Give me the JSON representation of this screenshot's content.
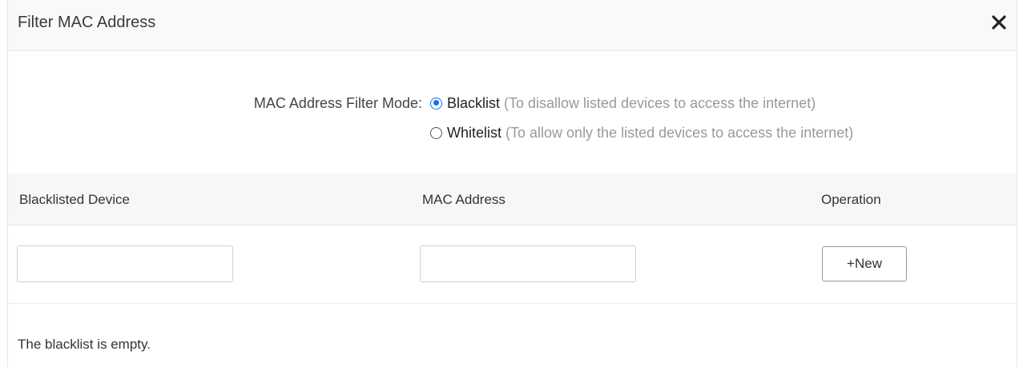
{
  "dialog": {
    "title": "Filter MAC Address",
    "close_icon": "close-icon"
  },
  "filter_mode": {
    "label": "MAC Address Filter Mode:",
    "selected": "Blacklist",
    "options": [
      {
        "name": "Blacklist",
        "description": "(To disallow listed devices to access the internet)",
        "checked": true
      },
      {
        "name": "Whitelist",
        "description": "(To allow only the listed devices to access the internet)",
        "checked": false
      }
    ]
  },
  "table": {
    "columns": [
      "Blacklisted Device",
      "MAC Address",
      "Operation"
    ],
    "device_input_value": "",
    "mac_input_value": "",
    "new_button_label": "+New",
    "empty_message": "The blacklist is empty."
  },
  "colors": {
    "accent": "#1a73e8",
    "header_bg": "#f9f9f9",
    "description_text": "#999999"
  }
}
